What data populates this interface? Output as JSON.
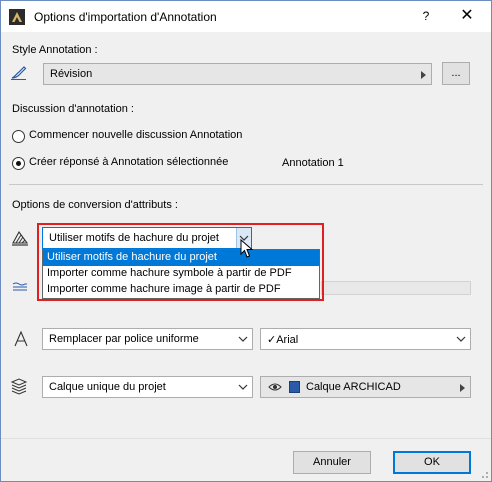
{
  "window": {
    "title": "Options d'importation d'Annotation",
    "help_label": "?",
    "close_label": "✕"
  },
  "style_section": {
    "label": "Style Annotation :",
    "value": "Révision",
    "more_label": "..."
  },
  "discussion_section": {
    "label": "Discussion d'annotation :",
    "option_new": "Commencer nouvelle discussion Annotation",
    "option_reply": "Créer réponsé à Annotation sélectionnée",
    "selected_option": "option_reply",
    "annotation_name": "Annotation 1"
  },
  "conversion_section": {
    "label": "Options de conversion d'attributs :",
    "hatch_select_value": "Utiliser motifs de hachure du projet",
    "hatch_options": [
      "Utiliser motifs de hachure du projet",
      "Importer comme hachure symbole à partir de PDF",
      "Importer comme hachure image à partir de PDF"
    ],
    "hatch_selected_index": 0,
    "font_select_value": "Remplacer par police uniforme",
    "font_name_value": "✓Arial",
    "layer_select_value": "Calque unique du projet",
    "layer_name_value": "Calque ARCHICAD"
  },
  "footer": {
    "cancel_label": "Annuler",
    "ok_label": "OK"
  },
  "colors": {
    "accent": "#0078d7",
    "highlight": "#e02020"
  }
}
